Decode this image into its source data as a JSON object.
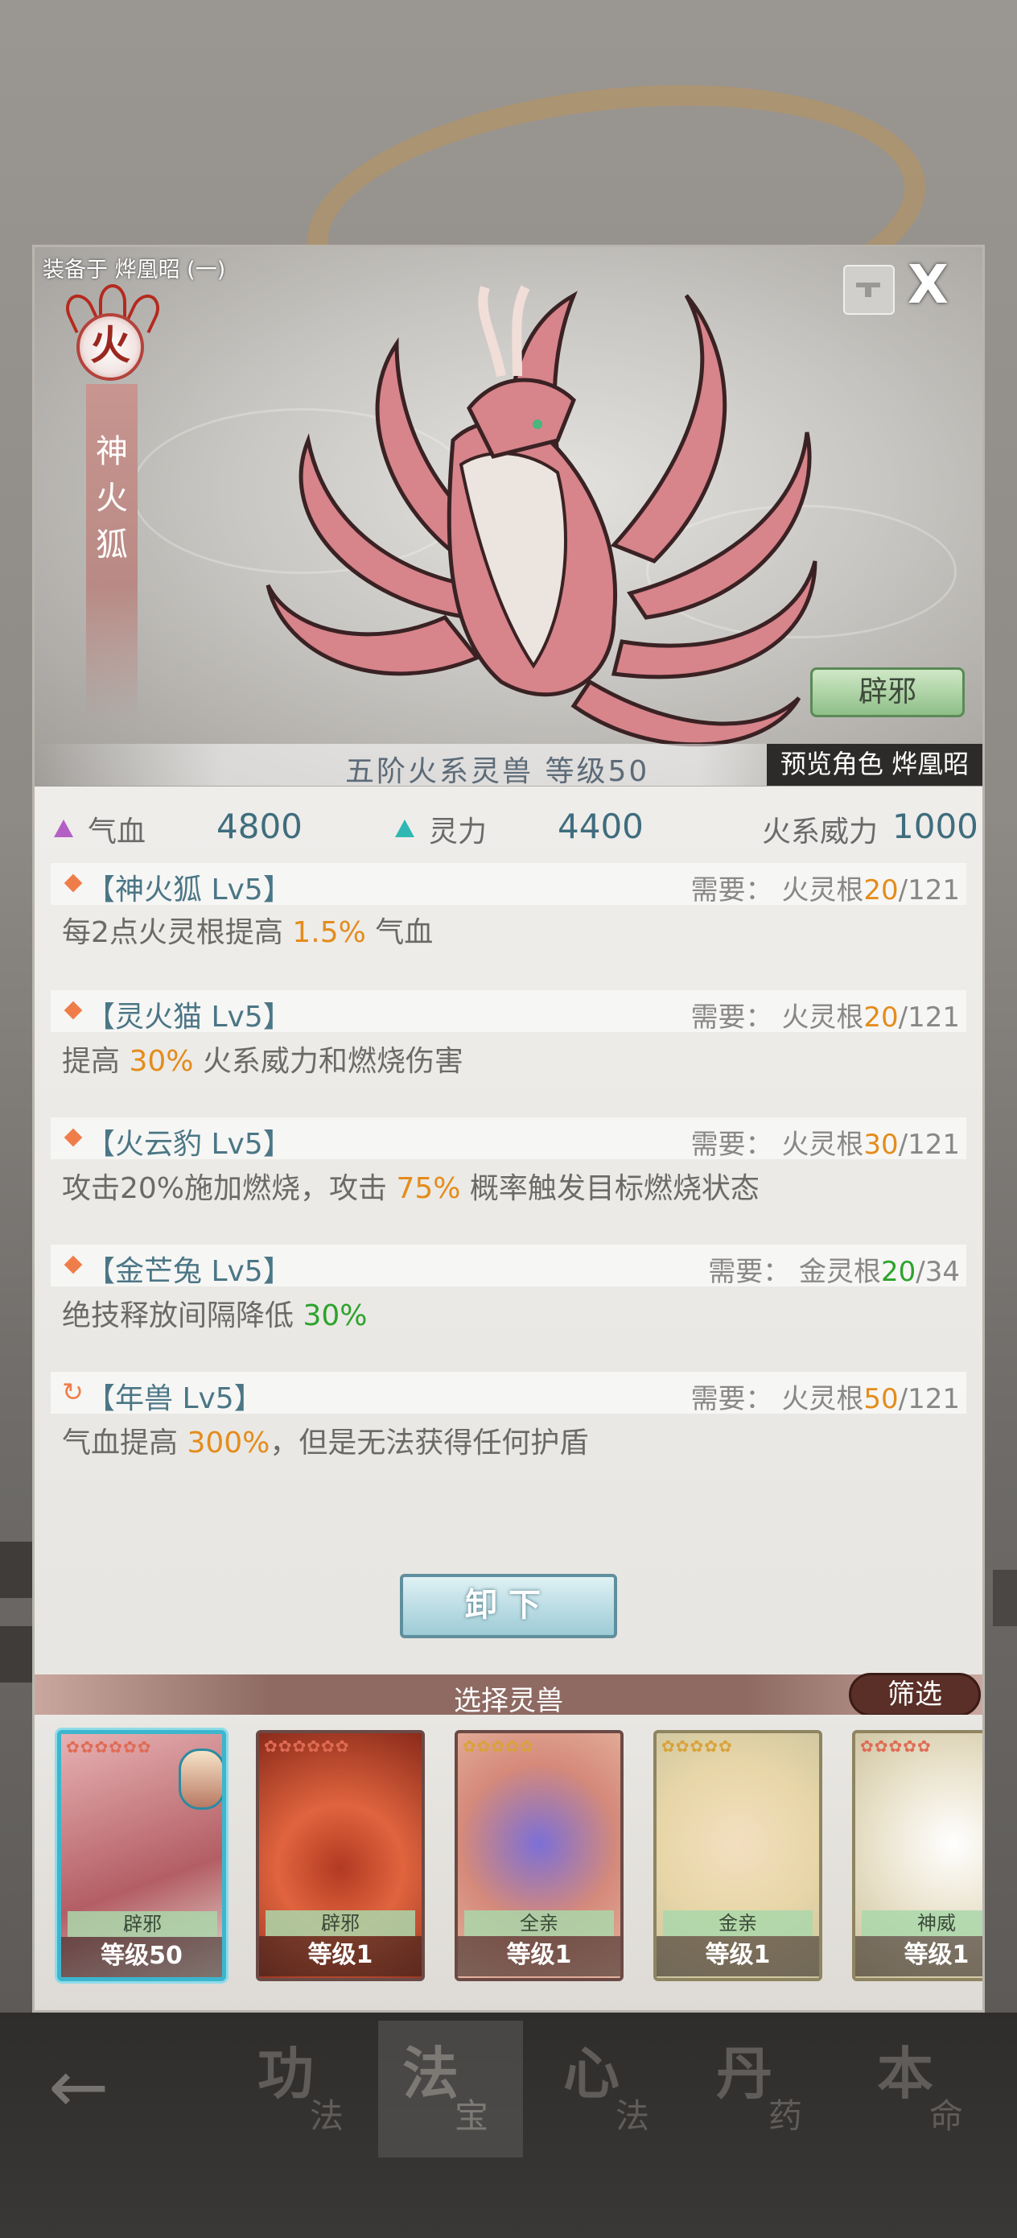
{
  "panel": {
    "equipped_label": "装备于 烨凰昭 (一)",
    "close_label": "X",
    "element_badge": "火",
    "beast_name": "神火狐",
    "trait_tag": "辟邪",
    "rank_text": "五阶火系灵兽 等级50",
    "preview_label": "预览角色 烨凰昭"
  },
  "stats": {
    "hp_label": "气血",
    "hp_value": "4800",
    "sp_label": "灵力",
    "sp_value": "4400",
    "fire_label": "火系威力",
    "fire_value": "1000",
    "hp_icon_color": "#b45fc4",
    "sp_icon_color": "#2fb8b3"
  },
  "skills": [
    {
      "name": "【神火狐 Lv5】",
      "req_prefix": "需要： 火灵根",
      "req_cur": "20",
      "req_max": "/121",
      "cur_color": "orange",
      "desc_a": "每2点火灵根提高 ",
      "desc_hl": "1.5%",
      "desc_b": " 气血",
      "icon": "diamond"
    },
    {
      "name": "【灵火猫 Lv5】",
      "req_prefix": "需要： 火灵根",
      "req_cur": "20",
      "req_max": "/121",
      "cur_color": "orange",
      "desc_a": "提高 ",
      "desc_hl": "30%",
      "desc_b": " 火系威力和燃烧伤害",
      "icon": "diamond"
    },
    {
      "name": "【火云豹 Lv5】",
      "req_prefix": "需要： 火灵根",
      "req_cur": "30",
      "req_max": "/121",
      "cur_color": "orange",
      "desc_a": "攻击20%施加燃烧，攻击 ",
      "desc_hl": "75%",
      "desc_b": " 概率触发目标燃烧状态",
      "icon": "diamond"
    },
    {
      "name": "【金芒兔 Lv5】",
      "req_prefix": "需要： 金灵根",
      "req_cur": "20",
      "req_max": "/34",
      "cur_color": "green",
      "desc_a": "绝技释放间隔降低 ",
      "desc_hl": "30%",
      "desc_b": "",
      "icon": "diamond"
    },
    {
      "name": "【年兽 Lv5】",
      "req_prefix": "需要： 火灵根",
      "req_cur": "50",
      "req_max": "/121",
      "cur_color": "orange",
      "desc_a": "气血提高 ",
      "desc_hl": "300%",
      "desc_b": "，但是无法获得任何护盾",
      "icon": "recycle-icon"
    }
  ],
  "unequip_label": "卸下",
  "select_title": "选择灵兽",
  "filter_label": "筛选",
  "cards": [
    {
      "tag": "辟邪",
      "level": "等级50",
      "selected": true
    },
    {
      "tag": "辟邪",
      "level": "等级1"
    },
    {
      "tag": "全亲",
      "level": "等级1"
    },
    {
      "tag": "金亲",
      "level": "等级1"
    },
    {
      "tag": "神威",
      "level": "等级1"
    }
  ],
  "bottom_nav": [
    {
      "big": "功",
      "small": "法"
    },
    {
      "big": "法",
      "small": "宝"
    },
    {
      "big": "心",
      "small": "法"
    },
    {
      "big": "丹",
      "small": "药"
    },
    {
      "big": "本",
      "small": "命"
    }
  ]
}
